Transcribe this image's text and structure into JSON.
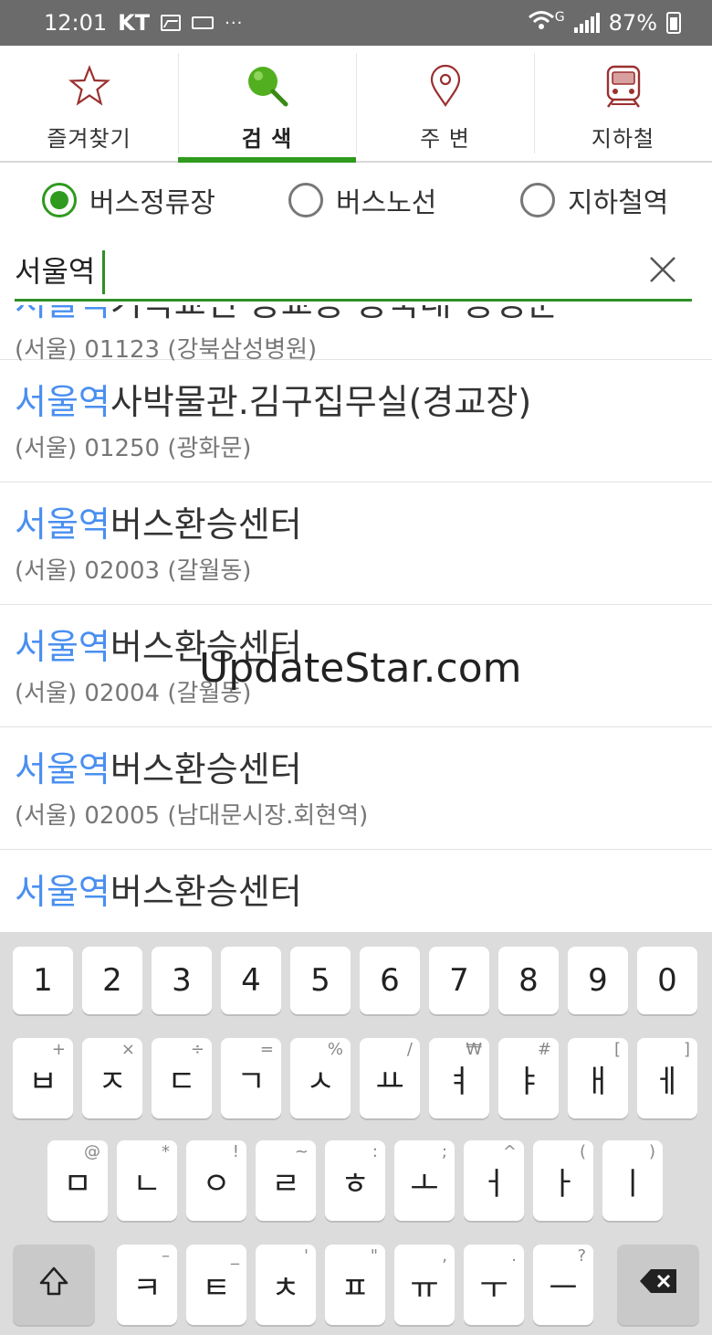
{
  "status_bar": {
    "time": "12:01",
    "carrier": "KT",
    "more": "···",
    "network": "G",
    "battery": "87%"
  },
  "tabs": [
    {
      "label": "즐겨찾기",
      "icon": "star-icon",
      "active": false
    },
    {
      "label": "검 색",
      "icon": "search-icon",
      "active": true
    },
    {
      "label": "주 변",
      "icon": "location-pin-icon",
      "active": false
    },
    {
      "label": "지하철",
      "icon": "subway-icon",
      "active": false
    }
  ],
  "search_types": [
    {
      "label": "버스정류장",
      "selected": true
    },
    {
      "label": "버스노선",
      "selected": false
    },
    {
      "label": "지하철역",
      "selected": false
    }
  ],
  "search": {
    "value": "서울역",
    "clear_icon": "close-icon"
  },
  "results": [
    {
      "highlight": "서울역",
      "rest": "기독교인·동교동·동국대 동명군",
      "sub": "(서울) 01123 (강북삼성병원)"
    },
    {
      "highlight": "서울역",
      "rest": "사박물관.김구집무실(경교장)",
      "sub": "(서울) 01250 (광화문)"
    },
    {
      "highlight": "서울역",
      "rest": "버스환승센터",
      "sub": "(서울) 02003 (갈월동)"
    },
    {
      "highlight": "서울역",
      "rest": "버스환승센터",
      "sub": "(서울) 02004 (갈월동)"
    },
    {
      "highlight": "서울역",
      "rest": "버스환승센터",
      "sub": "(서울) 02005 (남대문시장.회현역)"
    },
    {
      "highlight": "서울역",
      "rest": "버스환승센터",
      "sub": ""
    }
  ],
  "watermark": "UpdateStar.com",
  "keyboard": {
    "row1": [
      {
        "label": "1",
        "hint": ""
      },
      {
        "label": "2",
        "hint": ""
      },
      {
        "label": "3",
        "hint": ""
      },
      {
        "label": "4",
        "hint": ""
      },
      {
        "label": "5",
        "hint": ""
      },
      {
        "label": "6",
        "hint": ""
      },
      {
        "label": "7",
        "hint": ""
      },
      {
        "label": "8",
        "hint": ""
      },
      {
        "label": "9",
        "hint": ""
      },
      {
        "label": "0",
        "hint": ""
      }
    ],
    "row2": [
      {
        "label": "ㅂ",
        "hint": "+"
      },
      {
        "label": "ㅈ",
        "hint": "×"
      },
      {
        "label": "ㄷ",
        "hint": "÷"
      },
      {
        "label": "ㄱ",
        "hint": "="
      },
      {
        "label": "ㅅ",
        "hint": "%"
      },
      {
        "label": "ㅛ",
        "hint": "/"
      },
      {
        "label": "ㅕ",
        "hint": "₩"
      },
      {
        "label": "ㅑ",
        "hint": "#"
      },
      {
        "label": "ㅐ",
        "hint": "["
      },
      {
        "label": "ㅔ",
        "hint": "]"
      }
    ],
    "row3": [
      {
        "label": "ㅁ",
        "hint": "@"
      },
      {
        "label": "ㄴ",
        "hint": "*"
      },
      {
        "label": "ㅇ",
        "hint": "!"
      },
      {
        "label": "ㄹ",
        "hint": "~"
      },
      {
        "label": "ㅎ",
        "hint": ":"
      },
      {
        "label": "ㅗ",
        "hint": ";"
      },
      {
        "label": "ㅓ",
        "hint": "^"
      },
      {
        "label": "ㅏ",
        "hint": "("
      },
      {
        "label": "ㅣ",
        "hint": ")"
      }
    ],
    "row4": [
      {
        "label": "ㅋ",
        "hint": "–"
      },
      {
        "label": "ㅌ",
        "hint": "_"
      },
      {
        "label": "ㅊ",
        "hint": "'"
      },
      {
        "label": "ㅍ",
        "hint": "\""
      },
      {
        "label": "ㅠ",
        "hint": ","
      },
      {
        "label": "ㅜ",
        "hint": "."
      },
      {
        "label": "ㅡ",
        "hint": "?"
      }
    ],
    "shift_icon": "shift-arrow-icon",
    "backspace_icon": "backspace-icon"
  },
  "colors": {
    "accent_green": "#2f9a1d",
    "highlight_blue": "#4a8ff0",
    "status_bar_bg": "#6b6b6b",
    "keyboard_bg": "#dcdcdc"
  }
}
